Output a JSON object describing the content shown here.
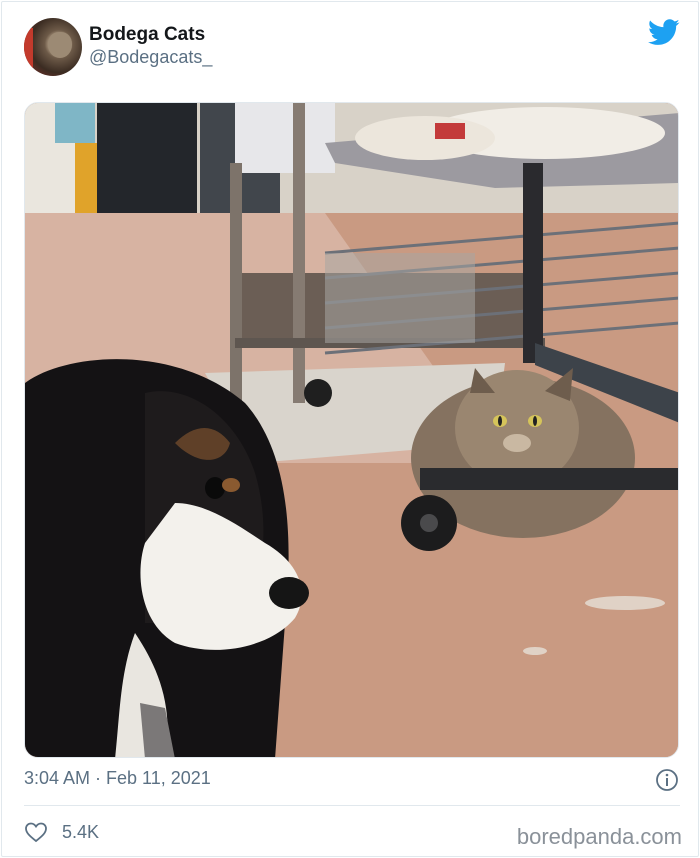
{
  "tweet": {
    "display_name": "Bodega Cats",
    "handle": "@Bodegacats_",
    "timestamp": "3:04 AM · Feb 11, 2021",
    "like_count": "5.4K",
    "icons": {
      "brand": "twitter-bird-icon",
      "info": "info-icon",
      "like": "heart-icon"
    },
    "accent_color": "#1da1f2"
  },
  "watermark": "boredpanda.com"
}
